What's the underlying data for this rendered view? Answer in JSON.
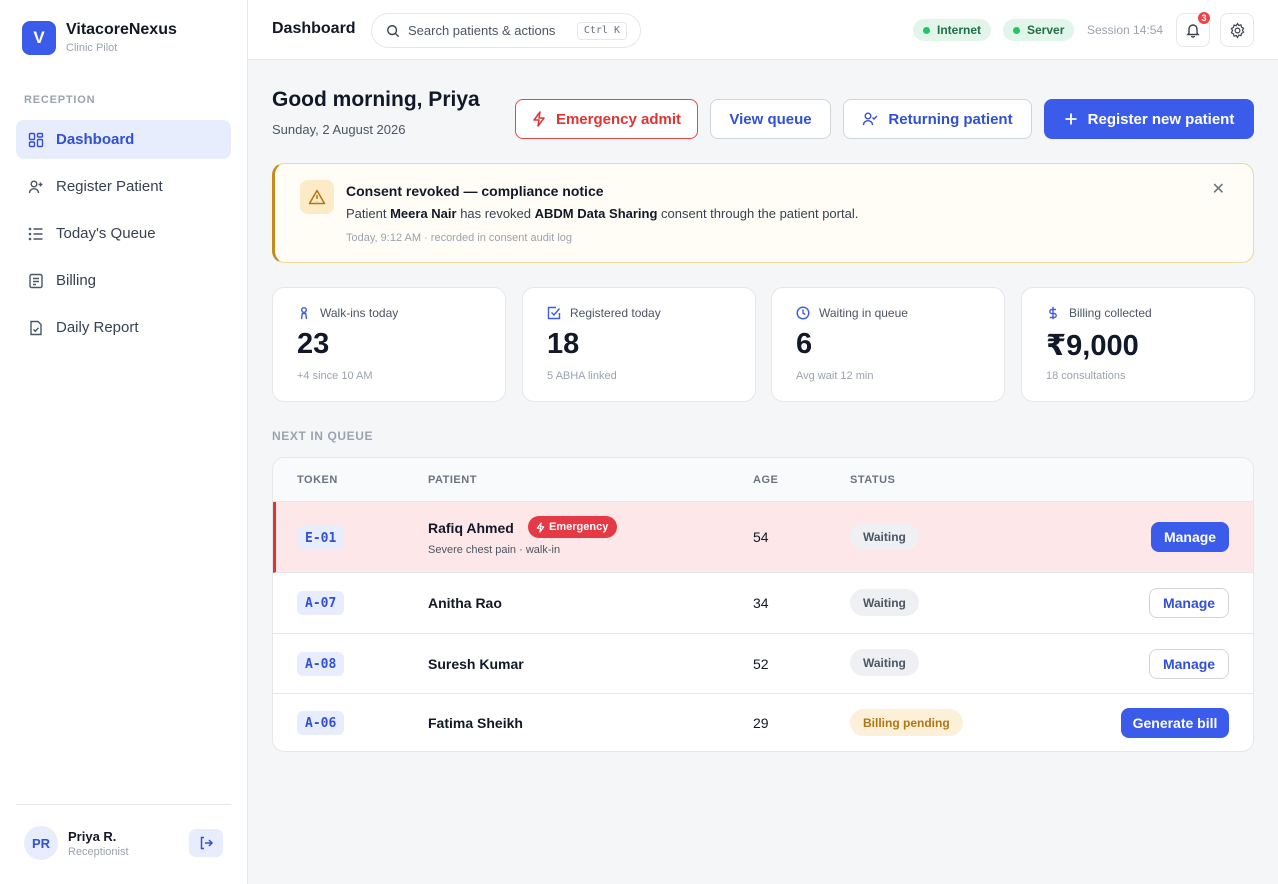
{
  "brand": {
    "initial": "V",
    "name": "VitacoreNexus",
    "sub": "Clinic Pilot"
  },
  "sidebar": {
    "section": "RECEPTION",
    "items": [
      {
        "label": "Dashboard",
        "icon": "grid-icon"
      },
      {
        "label": "Register Patient",
        "icon": "user-plus-icon"
      },
      {
        "label": "Today's Queue",
        "icon": "list-icon"
      },
      {
        "label": "Billing",
        "icon": "receipt-icon"
      },
      {
        "label": "Daily Report",
        "icon": "report-icon"
      }
    ]
  },
  "user": {
    "initials": "PR",
    "name": "Priya R.",
    "role": "Receptionist"
  },
  "topbar": {
    "title": "Dashboard",
    "search_placeholder": "Search patients & actions",
    "shortcut": "Ctrl K",
    "internet": "Internet",
    "server": "Server",
    "session": "Session 14:54",
    "notifications": "3"
  },
  "greeting": {
    "title": "Good morning, Priya",
    "date": "Sunday, 2 August 2026"
  },
  "actions": {
    "emergency": "Emergency admit",
    "queue": "View queue",
    "returning": "Returning patient",
    "register": "Register new patient"
  },
  "alert": {
    "title": "Consent revoked — compliance notice",
    "pre": "Patient ",
    "patient": "Meera Nair",
    "mid": " has revoked ",
    "consent": "ABDM Data Sharing",
    "post": " consent through the patient portal.",
    "meta": "Today, 9:12 AM · recorded in consent audit log"
  },
  "stats": [
    {
      "label": "Walk-ins today",
      "value": "23",
      "sub": "+4 since 10 AM"
    },
    {
      "label": "Registered today",
      "value": "18",
      "sub": "5 ABHA linked"
    },
    {
      "label": "Waiting in queue",
      "value": "6",
      "sub": "Avg wait 12 min"
    },
    {
      "label": "Billing collected",
      "value": "₹9,000",
      "sub": "18 consultations"
    }
  ],
  "queue": {
    "label": "NEXT IN QUEUE",
    "headers": {
      "token": "TOKEN",
      "patient": "PATIENT",
      "age": "AGE",
      "status": "STATUS"
    },
    "rows": [
      {
        "token": "E-01",
        "name": "Rafiq Ahmed",
        "badge": "Emergency",
        "sub": "Severe chest pain · walk-in",
        "age": "54",
        "status": "Waiting",
        "action": "Manage"
      },
      {
        "token": "A-07",
        "name": "Anitha Rao",
        "age": "34",
        "status": "Waiting",
        "action": "Manage"
      },
      {
        "token": "A-08",
        "name": "Suresh Kumar",
        "age": "52",
        "status": "Waiting",
        "action": "Manage"
      },
      {
        "token": "A-06",
        "name": "Fatima Sheikh",
        "age": "29",
        "status": "Billing pending",
        "action": "Generate bill"
      }
    ]
  },
  "colors": {
    "accent": "#3b5bea",
    "danger": "#e03434",
    "warning": "#c48a1b",
    "success": "#22c55e"
  }
}
